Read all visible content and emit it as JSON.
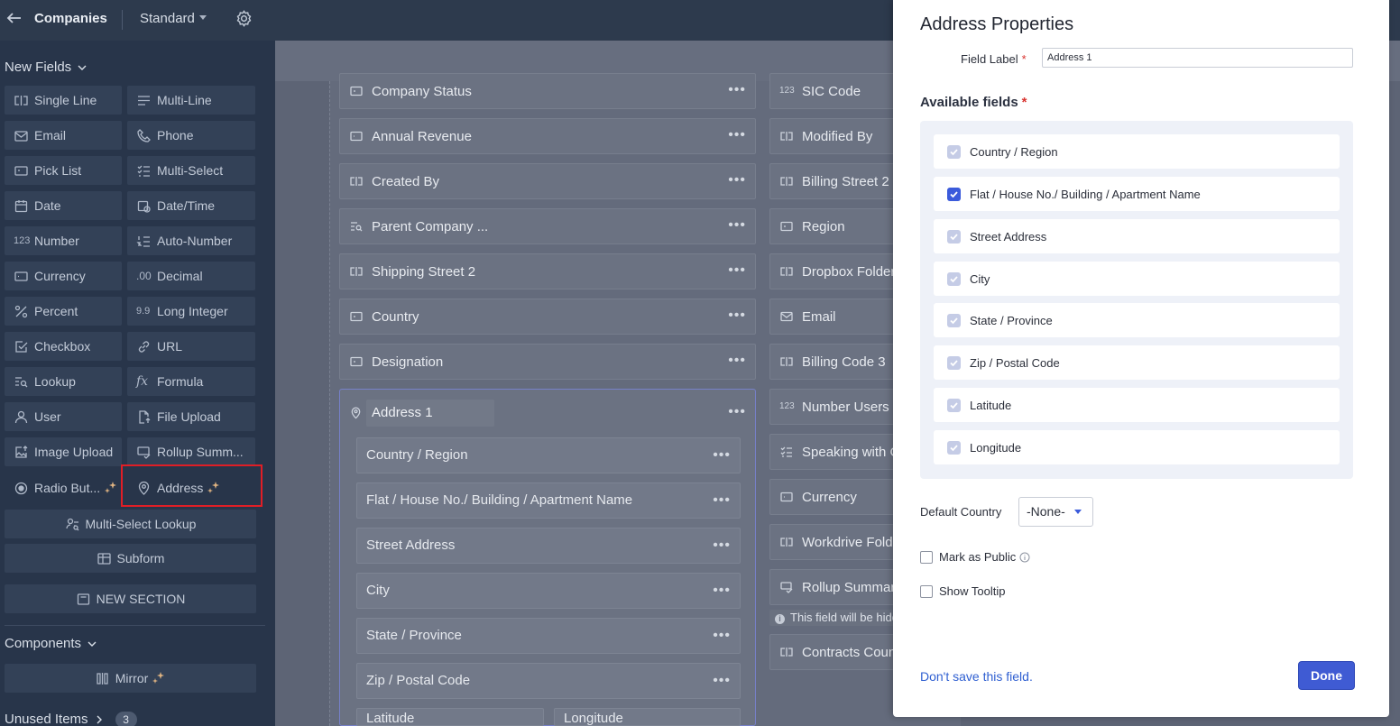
{
  "topbar": {
    "module": "Companies",
    "layout": "Standard"
  },
  "sidebar": {
    "new_fields_heading": "New Fields",
    "fields": [
      {
        "label": "Single Line",
        "icon": "single-line-icon"
      },
      {
        "label": "Multi-Line",
        "icon": "multi-line-icon"
      },
      {
        "label": "Email",
        "icon": "email-icon"
      },
      {
        "label": "Phone",
        "icon": "phone-icon"
      },
      {
        "label": "Pick List",
        "icon": "pick-list-icon"
      },
      {
        "label": "Multi-Select",
        "icon": "multi-select-icon"
      },
      {
        "label": "Date",
        "icon": "date-icon"
      },
      {
        "label": "Date/Time",
        "icon": "date-time-icon"
      },
      {
        "label": "Number",
        "icon": "number-icon"
      },
      {
        "label": "Auto-Number",
        "icon": "auto-number-icon"
      },
      {
        "label": "Currency",
        "icon": "currency-icon"
      },
      {
        "label": "Decimal",
        "icon": "decimal-icon"
      },
      {
        "label": "Percent",
        "icon": "percent-icon"
      },
      {
        "label": "Long Integer",
        "icon": "long-integer-icon"
      },
      {
        "label": "Checkbox",
        "icon": "checkbox-icon"
      },
      {
        "label": "URL",
        "icon": "url-icon"
      },
      {
        "label": "Lookup",
        "icon": "lookup-icon"
      },
      {
        "label": "Formula",
        "icon": "formula-icon"
      },
      {
        "label": "User",
        "icon": "user-icon"
      },
      {
        "label": "File Upload",
        "icon": "file-upload-icon"
      },
      {
        "label": "Image Upload",
        "icon": "image-upload-icon"
      },
      {
        "label": "Rollup Summ...",
        "icon": "rollup-icon"
      },
      {
        "label": "Radio But...",
        "icon": "radio-button-icon"
      },
      {
        "label": "Address",
        "icon": "address-icon"
      }
    ],
    "multi_select_lookup": "Multi-Select Lookup",
    "subform": "Subform",
    "new_section": "NEW SECTION",
    "components_heading": "Components",
    "mirror": "Mirror",
    "unused_items": "Unused Items",
    "unused_count": "3"
  },
  "canvas": {
    "left_column": [
      "Company Status",
      "Annual Revenue",
      "Created By",
      "Parent Company ...",
      "Shipping Street 2",
      "Country",
      "Designation"
    ],
    "right_column": [
      "SIC Code",
      "Modified By",
      "Billing Street 2",
      "Region",
      "Dropbox Folder",
      "Email",
      "Billing Code 3",
      "Number Users R",
      "Speaking with C",
      "Currency",
      "Workdrive Folde",
      "Rollup Summar",
      "Contracts Coun"
    ],
    "hidden_note": "This field will be hidden",
    "address_block": {
      "title": "Address 1",
      "fields": [
        "Country / Region",
        "Flat / House No./ Building / Apartment Name",
        "Street Address",
        "City",
        "State / Province",
        "Zip / Postal Code"
      ],
      "bottom_left": "Latitude",
      "bottom_right": "Longitude"
    }
  },
  "panel": {
    "title": "Address Properties",
    "field_label_caption": "Field Label",
    "field_label_value": "Address 1",
    "available_fields_title": "Available fields",
    "available_fields": [
      {
        "label": "Country / Region",
        "state": "disabled"
      },
      {
        "label": "Flat / House No./ Building / Apartment Name",
        "state": "checked"
      },
      {
        "label": "Street Address",
        "state": "disabled"
      },
      {
        "label": "City",
        "state": "disabled"
      },
      {
        "label": "State / Province",
        "state": "disabled"
      },
      {
        "label": "Zip / Postal Code",
        "state": "disabled"
      },
      {
        "label": "Latitude",
        "state": "disabled"
      },
      {
        "label": "Longitude",
        "state": "disabled"
      }
    ],
    "default_country_label": "Default Country",
    "default_country_value": "-None-",
    "mark_as_public": "Mark as Public",
    "show_tooltip": "Show Tooltip",
    "dont_save": "Don't save this field.",
    "done": "Done"
  },
  "colors": {
    "accent": "#3f5bd3",
    "highlight": "#e01e26",
    "sidebar_bg": "#28354a",
    "topbar_bg": "#2d3a4d"
  }
}
